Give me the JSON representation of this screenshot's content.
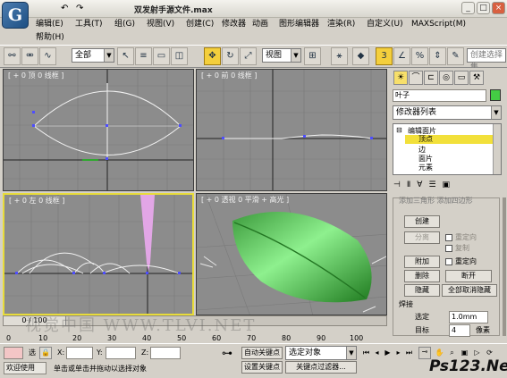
{
  "window": {
    "title": "双发射手源文件.max",
    "minimize": "_",
    "maximize": "□",
    "close": "×"
  },
  "menu": {
    "items": [
      "编辑(E)",
      "工具(T)",
      "组(G)",
      "视图(V)",
      "创建(C)",
      "修改器",
      "动画",
      "图形编辑器",
      "渲染(R)",
      "自定义(U)",
      "MAXScript(M)",
      "帮助(H)"
    ]
  },
  "toolbar": {
    "selection_filter": "全部",
    "ref_coord": "视图",
    "named_selection": "创建选择集",
    "icons": [
      "select-link-icon",
      "unlink-icon",
      "bind-spacewarp-icon",
      "select-icon",
      "select-by-name-icon",
      "rect-region-icon",
      "window-crossing-icon",
      "move-icon",
      "rotate-icon",
      "scale-icon",
      "pivot-icon",
      "mirror-icon",
      "align-icon",
      "layers-icon",
      "curve-editor-icon",
      "schematic-icon",
      "material-editor-icon",
      "render-icon",
      "snap-3-icon",
      "angle-snap-icon",
      "percent-snap-icon"
    ]
  },
  "viewports": {
    "top": {
      "label": "[ + 0 顶 0 线框 ]"
    },
    "front": {
      "label": "[ + 0 前 0 线框 ]"
    },
    "left": {
      "label": "[ + 0 左 0 线框 ]"
    },
    "persp": {
      "label": "[ + 0 透视 0 平滑 + 高光 ]"
    }
  },
  "command_panel": {
    "object_name": "叶子",
    "object_color": "#44cc44",
    "modifier_list": "修改器列表",
    "stack": [
      {
        "label": "编辑面片",
        "expander": "⊟",
        "selected": false
      },
      {
        "label": "顶点",
        "selected": true
      },
      {
        "label": "边",
        "selected": false
      },
      {
        "label": "面片",
        "selected": false
      },
      {
        "label": "元素",
        "selected": false
      }
    ],
    "partial_header": "添加三角形 添加四边形",
    "buttons": {
      "create": "创建",
      "detach": "分离",
      "attach": "附加",
      "delete": "删除",
      "break": "断开",
      "hide": "隐藏",
      "unhide_all": "全部取消隐藏"
    },
    "checks": {
      "reorient1": "重定向",
      "copy": "复制",
      "reorient2": "重定向"
    },
    "weld": {
      "title": "焊接",
      "selected_label": "选定",
      "selected_value": "1.0mm",
      "target_label": "目标",
      "target_value": "4",
      "target_unit": "像素"
    }
  },
  "timeline": {
    "frame": "0 / 100",
    "ticks": [
      "0",
      "10",
      "20",
      "30",
      "40",
      "50",
      "60",
      "70",
      "80",
      "90",
      "100"
    ]
  },
  "status": {
    "x_label": "X:",
    "y_label": "Y:",
    "z_label": "Z:",
    "auto_key": "自动关键点",
    "key_mode": "选定对象",
    "set_key": "设置关键点",
    "key_filter": "关键点过滤器...",
    "welcome": "欢迎使用",
    "prompt": "单击或单击并拖动以选择对象",
    "selected_prefix": "选"
  },
  "watermarks": {
    "site": "视觉中国 WWW.TLVI.NET",
    "corner": "Ps123.Net"
  }
}
